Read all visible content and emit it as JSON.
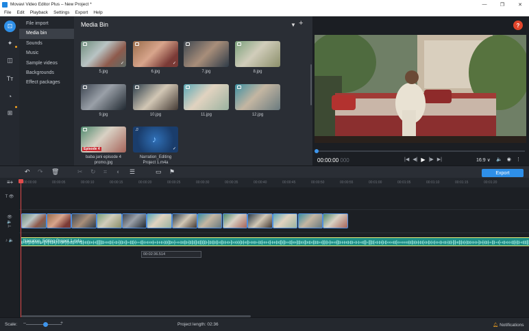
{
  "window": {
    "title": "Movavi Video Editor Plus – New Project *",
    "controls": [
      "—",
      "❐",
      "✕"
    ]
  },
  "menu": [
    "File",
    "Edit",
    "Playback",
    "Settings",
    "Export",
    "Help"
  ],
  "rail": {
    "tools": [
      "import-icon",
      "magic-icon",
      "transitions-icon",
      "titles-icon",
      "stickers-icon",
      "more-tools-icon"
    ]
  },
  "categories": {
    "items": [
      "File import",
      "Media bin",
      "Sounds",
      "Music",
      "Sample videos",
      "Backgrounds",
      "Effect packages"
    ],
    "selected": "Media bin"
  },
  "media_bin": {
    "title": "Media Bin",
    "items": [
      {
        "label": "5.jpg",
        "type": "image",
        "checked": true
      },
      {
        "label": "6.jpg",
        "type": "image",
        "checked": true
      },
      {
        "label": "7.jpg",
        "type": "image",
        "checked": false
      },
      {
        "label": "8.jpg",
        "type": "image",
        "checked": false
      },
      {
        "label": "9.jpg",
        "type": "image",
        "checked": false
      },
      {
        "label": "10.jpg",
        "type": "image",
        "checked": false
      },
      {
        "label": "11.jpg",
        "type": "image",
        "checked": false
      },
      {
        "label": "12.jpg",
        "type": "image",
        "checked": false
      },
      {
        "label": "baba jani episode 4 promo.jpg",
        "type": "image",
        "checked": false,
        "badge": "Episode 4"
      },
      {
        "label": "Narration_Editing Project 1.m4a",
        "type": "audio",
        "checked": true
      }
    ]
  },
  "preview": {
    "help": "?",
    "timecode": "00:00:00",
    "timecode_frames": "000",
    "aspect": "16:9 ∨",
    "controls": [
      "|◀",
      "◀|",
      "▶",
      "|▶",
      "▶|"
    ],
    "right_icons": [
      "🔈",
      "◉",
      "⋮"
    ]
  },
  "toolbar": {
    "export_label": "Export"
  },
  "ruler": {
    "ticks": [
      "00:00:00",
      "00:00:05",
      "00:00:10",
      "00:00:15",
      "00:00:20",
      "00:00:25",
      "00:00:30",
      "00:00:35",
      "00:00:40",
      "00:00:45",
      "00:00:50",
      "00:00:55",
      "00:01:00",
      "00:01:05",
      "00:01:10",
      "00:01:15",
      "00:01:20"
    ]
  },
  "timeline": {
    "clips": 13,
    "audio_clip_name": "Narration_Editing Project 1.m4a",
    "tooltip": "00:02:36.514"
  },
  "status": {
    "scale_label": "Scale:",
    "project_length": "Project length:  02:36",
    "notifications": "Notifications"
  }
}
